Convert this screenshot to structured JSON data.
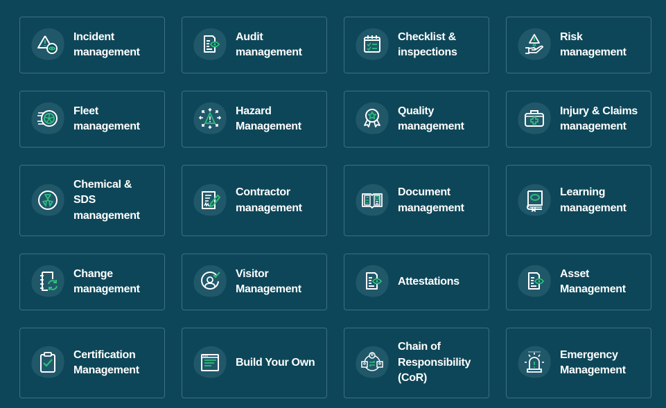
{
  "colors": {
    "background": "#0d4658",
    "card_border": "#3f7080",
    "icon_blob": "#20586a",
    "icon_line": "#ffffff",
    "icon_accent": "#2ebf7a"
  },
  "modules": [
    {
      "id": "incident",
      "label": "Incident\nmanagement",
      "icon": "warning-eye-icon"
    },
    {
      "id": "audit",
      "label": "Audit\nmanagement",
      "icon": "document-eye-icon"
    },
    {
      "id": "checklist",
      "label": "Checklist &\ninspections",
      "icon": "calendar-checklist-icon"
    },
    {
      "id": "risk",
      "label": "Risk\nmanagement",
      "icon": "hand-warning-icon"
    },
    {
      "id": "fleet",
      "label": "Fleet\nmanagement",
      "icon": "wheel-icon"
    },
    {
      "id": "hazard",
      "label": "Hazard\nManagement",
      "icon": "hazard-burst-icon"
    },
    {
      "id": "quality",
      "label": "Quality\nmanagement",
      "icon": "award-ribbon-icon"
    },
    {
      "id": "injury",
      "label": "Injury & Claims\nmanagement",
      "icon": "first-aid-kit-icon"
    },
    {
      "id": "chemical",
      "label": "Chemical &\nSDS\nmanagement",
      "icon": "radiation-icon"
    },
    {
      "id": "contractor",
      "label": "Contractor\nmanagement",
      "icon": "contract-signature-icon"
    },
    {
      "id": "document",
      "label": "Document\nmanagement",
      "icon": "open-book-icon"
    },
    {
      "id": "learning",
      "label": "Learning\nmanagement",
      "icon": "book-bookmark-icon"
    },
    {
      "id": "change",
      "label": "Change\nmanagement",
      "icon": "notebook-refresh-icon"
    },
    {
      "id": "visitor",
      "label": "Visitor\nManagement",
      "icon": "user-check-icon"
    },
    {
      "id": "attestations",
      "label": "Attestations",
      "icon": "document-eye-icon"
    },
    {
      "id": "asset",
      "label": "Asset\nManagement",
      "icon": "document-eye-icon"
    },
    {
      "id": "certification",
      "label": "Certification\nManagement",
      "icon": "clipboard-check-icon"
    },
    {
      "id": "build",
      "label": "Build Your Own",
      "icon": "browser-window-icon"
    },
    {
      "id": "cor",
      "label": "Chain of\nResponsibility\n(CoR)",
      "icon": "people-network-icon"
    },
    {
      "id": "emergency",
      "label": "Emergency\nManagement",
      "icon": "siren-icon"
    }
  ]
}
